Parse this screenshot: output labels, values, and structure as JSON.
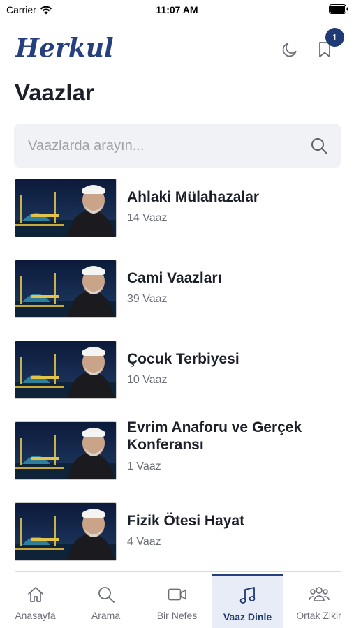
{
  "status_bar": {
    "carrier": "Carrier",
    "time": "11:07 AM"
  },
  "header": {
    "logo": "Herkul",
    "bookmark_count": "1"
  },
  "page": {
    "title": "Vaazlar"
  },
  "search": {
    "placeholder": "Vaazlarda arayın..."
  },
  "items": [
    {
      "title": "Ahlaki Mülahazalar",
      "count": "14 Vaaz"
    },
    {
      "title": "Cami Vaazları",
      "count": "39 Vaaz"
    },
    {
      "title": "Çocuk Terbiyesi",
      "count": "10 Vaaz"
    },
    {
      "title": "Evrim Anaforu ve Gerçek Konferansı",
      "count": "1 Vaaz"
    },
    {
      "title": "Fizik Ötesi Hayat",
      "count": "4 Vaaz"
    }
  ],
  "tabs": [
    {
      "label": "Anasayfa",
      "icon": "home-icon",
      "active": false
    },
    {
      "label": "Arama",
      "icon": "search-icon",
      "active": false
    },
    {
      "label": "Bir Nefes",
      "icon": "video-icon",
      "active": false
    },
    {
      "label": "Vaaz Dinle",
      "icon": "music-note-icon",
      "active": true
    },
    {
      "label": "Ortak Zikir",
      "icon": "group-icon",
      "active": false
    }
  ],
  "colors": {
    "brand": "#26407f",
    "badge": "#1f3a75",
    "active_tab_bg": "#e7ecf6"
  }
}
